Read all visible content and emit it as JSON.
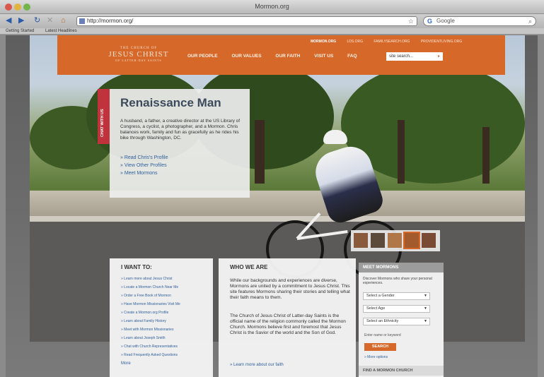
{
  "window": {
    "title": "Mormon.org"
  },
  "toolbar": {
    "url": "http://mormon.org/",
    "search_engine": "Google",
    "icons": [
      "back-icon",
      "forward-icon",
      "reload-icon",
      "stop-icon",
      "home-icon"
    ]
  },
  "bookmarks": [
    "Getting Started",
    "Latest Headlines"
  ],
  "header": {
    "logo_top": "THE CHURCH OF",
    "logo_name": "JESUS CHRIST",
    "logo_bottom": "OF LATTER-DAY SAINTS",
    "top_links": [
      "MORMON.ORG",
      "LDS.ORG",
      "FAMILYSEARCH.ORG",
      "PROVIDENTLIVING.ORG"
    ],
    "nav": [
      "OUR PEOPLE",
      "OUR VALUES",
      "OUR FAITH",
      "VISIT US",
      "FAQ"
    ],
    "search_placeholder": "site search..."
  },
  "side_tab": {
    "label": "CHAT WITH US"
  },
  "profile": {
    "title": "Renaissance Man",
    "description": "A husband, a father, a creative director at the US Library of Congress, a cyclist, a photographer, and a Mormon. Chris balances work, family and fun as gracefully as he rides his bike through Washington, DC.",
    "links": [
      "» Read Chris's Profile",
      "» View Other Profiles",
      "» Meet Mormons"
    ]
  },
  "i_want_to": {
    "title": "I WANT TO:",
    "items": [
      "» Learn more about Jesus Christ",
      "» Locate a Mormon Church Near Me",
      "» Order a Free Book of Mormon",
      "» Have Mormon Missionaries Visit Me",
      "» Create a Mormon.org Profile",
      "» Learn about Family History",
      "» Meet with Mormon Missionaries",
      "» Learn about Joseph Smith",
      "» Chat with Church Representatives",
      "» Read Frequently Asked Questions"
    ],
    "more": "More"
  },
  "who_we_are": {
    "title": "WHO WE ARE",
    "paragraph1": "While our backgrounds and experiences are diverse, Mormons are united by a commitment to Jesus Christ. This site features Mormons sharing their stories and telling what their faith means to them.",
    "paragraph2": "The Church of Jesus Christ of Latter-day Saints is the official name of the religion commonly called the Mormon Church. Mormons believe first and foremost that Jesus Christ is the Savior of the world and the Son of God.",
    "link": "» Learn more about our faith"
  },
  "meet_mormons": {
    "title": "MEET MORMONS",
    "description": "Discover Mormons who share your personal experiences.",
    "selects": [
      "Select a Gender",
      "Select Age",
      "Select an Ethnicity"
    ],
    "keyword_label": "Enter name or keyword",
    "button": "SEARCH",
    "more_options": "» More options",
    "find_church": "FIND A MORMON CHURCH"
  },
  "colors": {
    "brand_orange": "#d6692a",
    "chat_red": "#c0333d",
    "link_blue": "#2f5f9c",
    "heading_slate": "#3c4a5c"
  }
}
